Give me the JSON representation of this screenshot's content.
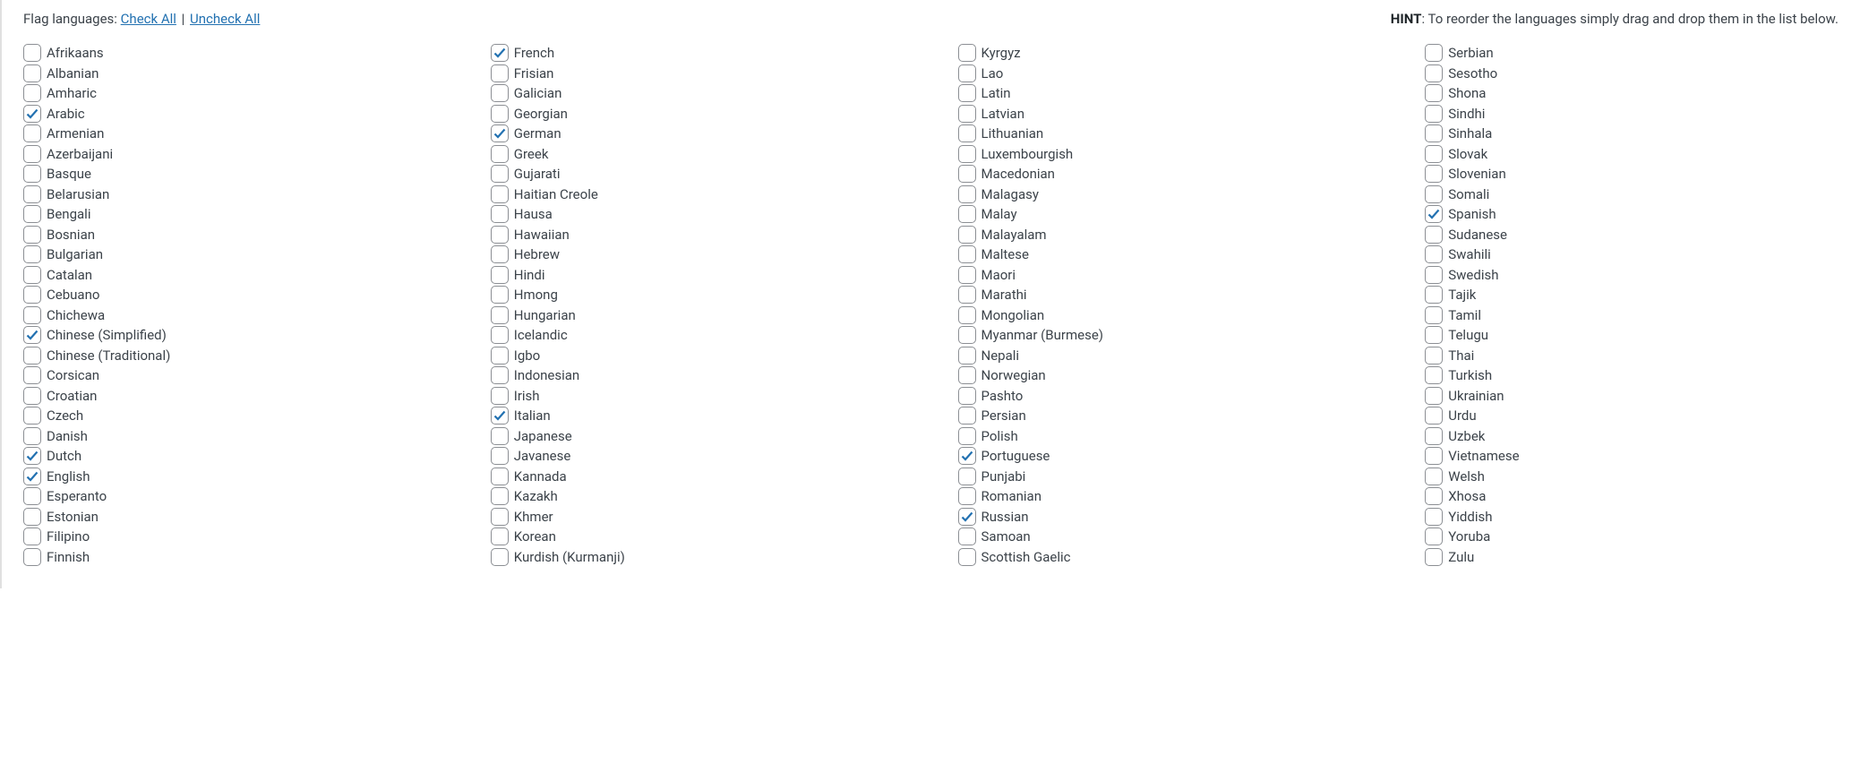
{
  "header": {
    "flagLanguagesLabel": "Flag languages:",
    "checkAllLabel": "Check All",
    "uncheckAllLabel": "Uncheck All",
    "divider": "|",
    "hintLabel": "HINT",
    "hintText": ": To reorder the languages simply drag and drop them in the list below."
  },
  "columns": [
    [
      {
        "label": "Afrikaans",
        "checked": false
      },
      {
        "label": "Albanian",
        "checked": false
      },
      {
        "label": "Amharic",
        "checked": false
      },
      {
        "label": "Arabic",
        "checked": true
      },
      {
        "label": "Armenian",
        "checked": false
      },
      {
        "label": "Azerbaijani",
        "checked": false
      },
      {
        "label": "Basque",
        "checked": false
      },
      {
        "label": "Belarusian",
        "checked": false
      },
      {
        "label": "Bengali",
        "checked": false
      },
      {
        "label": "Bosnian",
        "checked": false
      },
      {
        "label": "Bulgarian",
        "checked": false
      },
      {
        "label": "Catalan",
        "checked": false
      },
      {
        "label": "Cebuano",
        "checked": false
      },
      {
        "label": "Chichewa",
        "checked": false
      },
      {
        "label": "Chinese (Simplified)",
        "checked": true
      },
      {
        "label": "Chinese (Traditional)",
        "checked": false
      },
      {
        "label": "Corsican",
        "checked": false
      },
      {
        "label": "Croatian",
        "checked": false
      },
      {
        "label": "Czech",
        "checked": false
      },
      {
        "label": "Danish",
        "checked": false
      },
      {
        "label": "Dutch",
        "checked": true
      },
      {
        "label": "English",
        "checked": true
      },
      {
        "label": "Esperanto",
        "checked": false
      },
      {
        "label": "Estonian",
        "checked": false
      },
      {
        "label": "Filipino",
        "checked": false
      },
      {
        "label": "Finnish",
        "checked": false
      }
    ],
    [
      {
        "label": "French",
        "checked": true
      },
      {
        "label": "Frisian",
        "checked": false
      },
      {
        "label": "Galician",
        "checked": false
      },
      {
        "label": "Georgian",
        "checked": false
      },
      {
        "label": "German",
        "checked": true
      },
      {
        "label": "Greek",
        "checked": false
      },
      {
        "label": "Gujarati",
        "checked": false
      },
      {
        "label": "Haitian Creole",
        "checked": false
      },
      {
        "label": "Hausa",
        "checked": false
      },
      {
        "label": "Hawaiian",
        "checked": false
      },
      {
        "label": "Hebrew",
        "checked": false
      },
      {
        "label": "Hindi",
        "checked": false
      },
      {
        "label": "Hmong",
        "checked": false
      },
      {
        "label": "Hungarian",
        "checked": false
      },
      {
        "label": "Icelandic",
        "checked": false
      },
      {
        "label": "Igbo",
        "checked": false
      },
      {
        "label": "Indonesian",
        "checked": false
      },
      {
        "label": "Irish",
        "checked": false
      },
      {
        "label": "Italian",
        "checked": true
      },
      {
        "label": "Japanese",
        "checked": false
      },
      {
        "label": "Javanese",
        "checked": false
      },
      {
        "label": "Kannada",
        "checked": false
      },
      {
        "label": "Kazakh",
        "checked": false
      },
      {
        "label": "Khmer",
        "checked": false
      },
      {
        "label": "Korean",
        "checked": false
      },
      {
        "label": "Kurdish (Kurmanji)",
        "checked": false
      }
    ],
    [
      {
        "label": "Kyrgyz",
        "checked": false
      },
      {
        "label": "Lao",
        "checked": false
      },
      {
        "label": "Latin",
        "checked": false
      },
      {
        "label": "Latvian",
        "checked": false
      },
      {
        "label": "Lithuanian",
        "checked": false
      },
      {
        "label": "Luxembourgish",
        "checked": false
      },
      {
        "label": "Macedonian",
        "checked": false
      },
      {
        "label": "Malagasy",
        "checked": false
      },
      {
        "label": "Malay",
        "checked": false
      },
      {
        "label": "Malayalam",
        "checked": false
      },
      {
        "label": "Maltese",
        "checked": false
      },
      {
        "label": "Maori",
        "checked": false
      },
      {
        "label": "Marathi",
        "checked": false
      },
      {
        "label": "Mongolian",
        "checked": false
      },
      {
        "label": "Myanmar (Burmese)",
        "checked": false
      },
      {
        "label": "Nepali",
        "checked": false
      },
      {
        "label": "Norwegian",
        "checked": false
      },
      {
        "label": "Pashto",
        "checked": false
      },
      {
        "label": "Persian",
        "checked": false
      },
      {
        "label": "Polish",
        "checked": false
      },
      {
        "label": "Portuguese",
        "checked": true
      },
      {
        "label": "Punjabi",
        "checked": false
      },
      {
        "label": "Romanian",
        "checked": false
      },
      {
        "label": "Russian",
        "checked": true
      },
      {
        "label": "Samoan",
        "checked": false
      },
      {
        "label": "Scottish Gaelic",
        "checked": false
      }
    ],
    [
      {
        "label": "Serbian",
        "checked": false
      },
      {
        "label": "Sesotho",
        "checked": false
      },
      {
        "label": "Shona",
        "checked": false
      },
      {
        "label": "Sindhi",
        "checked": false
      },
      {
        "label": "Sinhala",
        "checked": false
      },
      {
        "label": "Slovak",
        "checked": false
      },
      {
        "label": "Slovenian",
        "checked": false
      },
      {
        "label": "Somali",
        "checked": false
      },
      {
        "label": "Spanish",
        "checked": true
      },
      {
        "label": "Sudanese",
        "checked": false
      },
      {
        "label": "Swahili",
        "checked": false
      },
      {
        "label": "Swedish",
        "checked": false
      },
      {
        "label": "Tajik",
        "checked": false
      },
      {
        "label": "Tamil",
        "checked": false
      },
      {
        "label": "Telugu",
        "checked": false
      },
      {
        "label": "Thai",
        "checked": false
      },
      {
        "label": "Turkish",
        "checked": false
      },
      {
        "label": "Ukrainian",
        "checked": false
      },
      {
        "label": "Urdu",
        "checked": false
      },
      {
        "label": "Uzbek",
        "checked": false
      },
      {
        "label": "Vietnamese",
        "checked": false
      },
      {
        "label": "Welsh",
        "checked": false
      },
      {
        "label": "Xhosa",
        "checked": false
      },
      {
        "label": "Yiddish",
        "checked": false
      },
      {
        "label": "Yoruba",
        "checked": false
      },
      {
        "label": "Zulu",
        "checked": false
      }
    ]
  ]
}
